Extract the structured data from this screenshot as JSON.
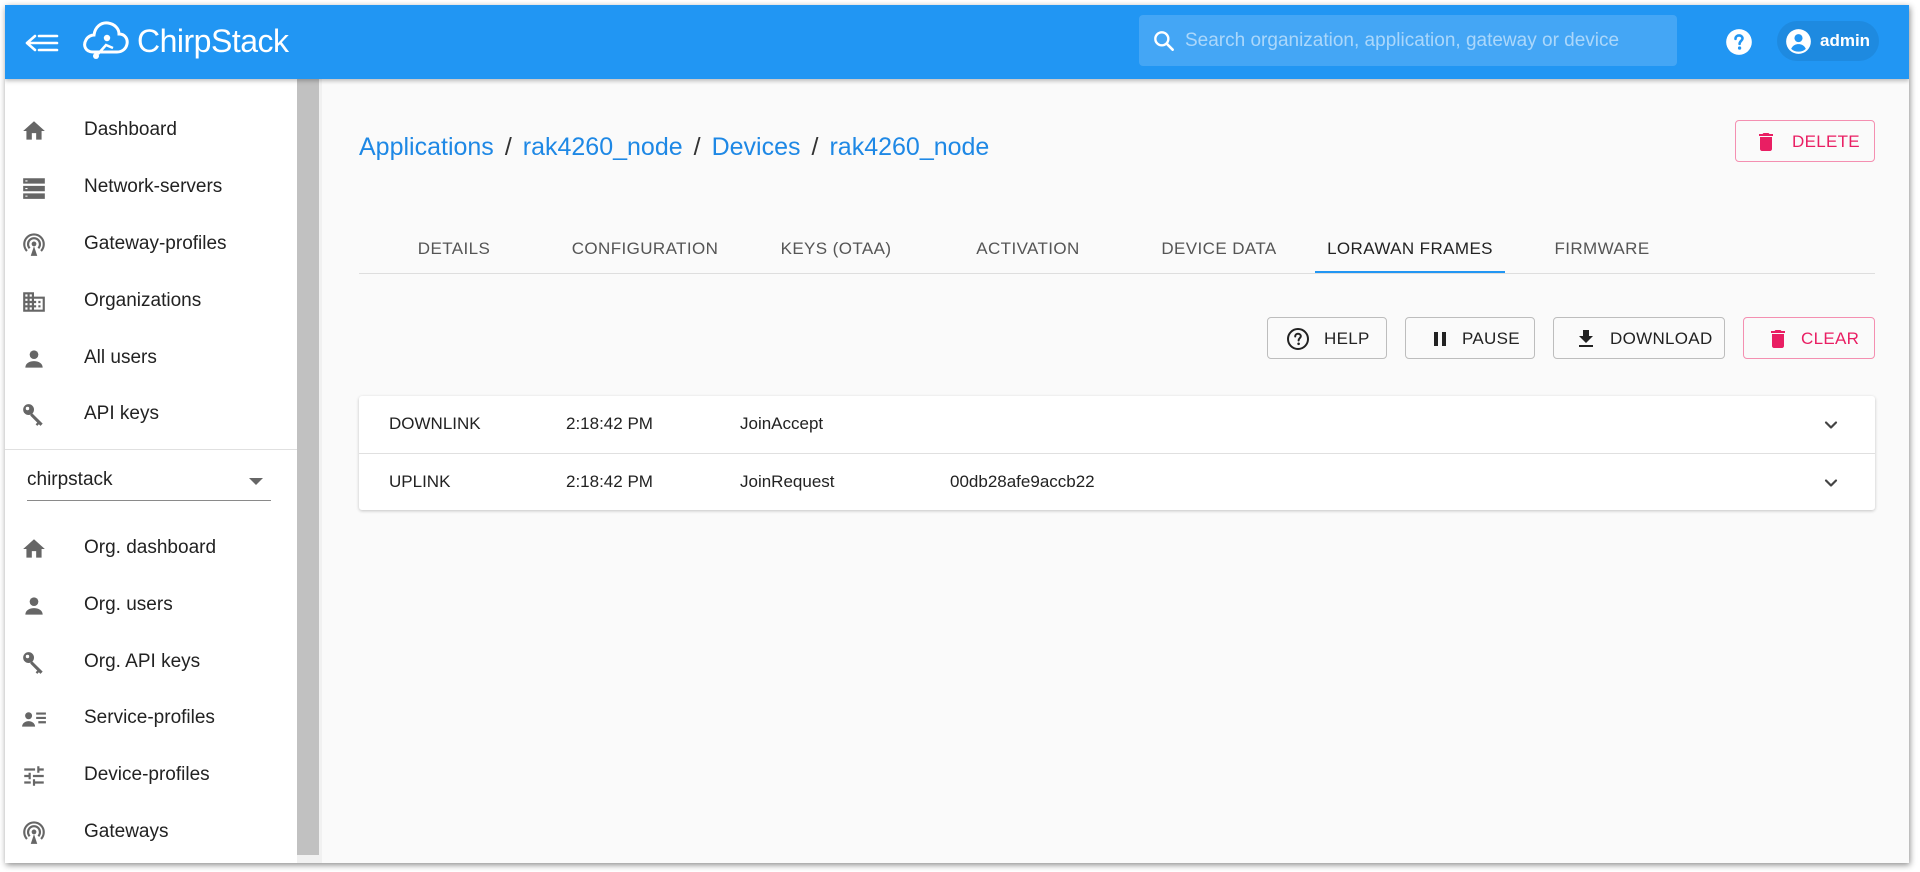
{
  "colors": {
    "primary": "#2196f3",
    "danger": "#e91e63",
    "link": "#1e88e5"
  },
  "topbar": {
    "brand": "ChirpStack",
    "search_placeholder": "Search organization, application, gateway or device",
    "user": "admin",
    "icons": [
      "back-arrow-icon",
      "chirpstack-logo",
      "search-icon",
      "help-icon",
      "account-circle-icon"
    ]
  },
  "sidebar": {
    "global_items": [
      {
        "label": "Dashboard",
        "icon": "home-icon"
      },
      {
        "label": "Network-servers",
        "icon": "server-icon"
      },
      {
        "label": "Gateway-profiles",
        "icon": "radio-tower-icon"
      },
      {
        "label": "Organizations",
        "icon": "domain-icon"
      },
      {
        "label": "All users",
        "icon": "person-icon"
      },
      {
        "label": "API keys",
        "icon": "key-icon"
      }
    ],
    "org_select": "chirpstack",
    "org_items": [
      {
        "label": "Org. dashboard",
        "icon": "home-icon"
      },
      {
        "label": "Org. users",
        "icon": "person-icon"
      },
      {
        "label": "Org. API keys",
        "icon": "key-icon"
      },
      {
        "label": "Service-profiles",
        "icon": "account-details-icon"
      },
      {
        "label": "Device-profiles",
        "icon": "tune-icon"
      },
      {
        "label": "Gateways",
        "icon": "radio-tower-icon"
      }
    ]
  },
  "breadcrumb": [
    "Applications",
    "rak4260_node",
    "Devices",
    "rak4260_node"
  ],
  "header_actions": {
    "delete": "DELETE"
  },
  "tabs": [
    {
      "label": "DETAILS",
      "active": false
    },
    {
      "label": "CONFIGURATION",
      "active": false
    },
    {
      "label": "KEYS (OTAA)",
      "active": false
    },
    {
      "label": "ACTIVATION",
      "active": false
    },
    {
      "label": "DEVICE DATA",
      "active": false
    },
    {
      "label": "LORAWAN FRAMES",
      "active": true
    },
    {
      "label": "FIRMWARE",
      "active": false
    }
  ],
  "frame_actions": {
    "help": "HELP",
    "pause": "PAUSE",
    "download": "DOWNLOAD",
    "clear": "CLEAR"
  },
  "frames": [
    {
      "direction": "DOWNLINK",
      "time": "2:18:42 PM",
      "type": "JoinAccept",
      "dev_eui": ""
    },
    {
      "direction": "UPLINK",
      "time": "2:18:42 PM",
      "type": "JoinRequest",
      "dev_eui": "00db28afe9accb22"
    }
  ]
}
